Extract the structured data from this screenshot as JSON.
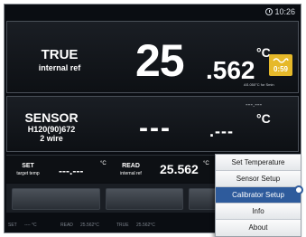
{
  "clock": {
    "time": "10:26"
  },
  "true_panel": {
    "title": "TRUE",
    "subtitle": "internal ref",
    "value_int": "25",
    "value_frac": ".562",
    "unit": "°C",
    "stability_value": "0:59",
    "stability_note": "AS.050°C for Smin"
  },
  "sensor_panel": {
    "title": "SENSOR",
    "model": "H120(90)672",
    "wire": "2 wire",
    "value_int": "---",
    "value_frac": ".---",
    "unit": "°C",
    "small_reading": "---.---"
  },
  "set_bar": {
    "set_label": "SET",
    "set_sub": "target temp",
    "set_value": "---.---",
    "set_unit": "°C",
    "read_label": "READ",
    "read_sub": "internal ref",
    "read_value": "25.562",
    "read_unit": "°C"
  },
  "status_bar": {
    "set": "SET",
    "set_value": "---- °C",
    "read": "READ",
    "read_value": "25.562°C",
    "true": "TRUE",
    "true_value": "25.562°C"
  },
  "menu": {
    "items": [
      "Set Temperature",
      "Sensor Setup",
      "Calibrator Setup",
      "Info",
      "About"
    ],
    "selected_index": 2
  },
  "colors": {
    "stability_badge": "#e6b92a",
    "menu_selected": "#2e5b9c"
  }
}
